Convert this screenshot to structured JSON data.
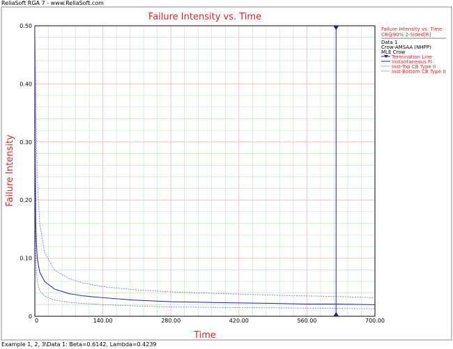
{
  "header": {
    "app_title": "ReliaSoft RGA 7 - www.ReliaSoft.com"
  },
  "footer": {
    "text": "Example 1, 2, 3\\Data 1: Beta=0.6142, Lambda=0.4239"
  },
  "colors": {
    "title": "#e8202a",
    "series_dark": "#1c1ca8",
    "series_light": "#6a6ae0",
    "grid_major": "#f4b4b4",
    "grid_minor": "#b8e8b8"
  },
  "chart_data": {
    "type": "line",
    "title": "Failure Intensity vs. Time",
    "xlabel": "Time",
    "ylabel": "Failure Intensity",
    "xlim": [
      0,
      700
    ],
    "ylim": [
      0,
      0.5
    ],
    "x_ticks": [
      "0",
      "140.00",
      "280.00",
      "420.00",
      "560.00",
      "700.00"
    ],
    "y_ticks": [
      "0",
      "0.10",
      "0.20",
      "0.30",
      "0.40",
      "0.50"
    ],
    "grid": true,
    "legend_position": "right",
    "legend": {
      "heading_1": "Failure Intensity vs. Time",
      "heading_2": "CB@90% 2-Sided[R]",
      "data_1": "Data 1",
      "data_2": "Crow-AMSAA (NHPP)",
      "data_3": "MLE Crow",
      "entries": [
        "Termination Line",
        "Instantaneous FI",
        "Inst-Top CB Type II",
        "Inst-Bottom CB Type II"
      ]
    },
    "termination_time": 620,
    "series": [
      {
        "name": "Instantaneous FI",
        "x": [
          1,
          2,
          3,
          5,
          10,
          20,
          40,
          70,
          100,
          140,
          200,
          280,
          350,
          420,
          500,
          560,
          620,
          700
        ],
        "y": [
          0.26,
          0.16,
          0.13,
          0.1,
          0.076,
          0.06,
          0.047,
          0.039,
          0.035,
          0.032,
          0.028,
          0.025,
          0.024,
          0.023,
          0.022,
          0.021,
          0.021,
          0.02
        ]
      },
      {
        "name": "Inst-Top CB Type II",
        "x": [
          2,
          3,
          5,
          10,
          20,
          40,
          70,
          100,
          140,
          200,
          280,
          350,
          420,
          500,
          560,
          620,
          700
        ],
        "y": [
          0.41,
          0.32,
          0.24,
          0.16,
          0.11,
          0.08,
          0.065,
          0.057,
          0.051,
          0.046,
          0.042,
          0.04,
          0.038,
          0.036,
          0.035,
          0.034,
          0.032
        ]
      },
      {
        "name": "Inst-Bottom CB Type II",
        "x": [
          1,
          2,
          3,
          5,
          10,
          20,
          40,
          70,
          100,
          140,
          200,
          280,
          350,
          420,
          500,
          560,
          620,
          700
        ],
        "y": [
          0.17,
          0.1,
          0.08,
          0.06,
          0.044,
          0.035,
          0.028,
          0.024,
          0.022,
          0.02,
          0.018,
          0.016,
          0.0155,
          0.015,
          0.0145,
          0.014,
          0.0135,
          0.013
        ]
      }
    ]
  }
}
